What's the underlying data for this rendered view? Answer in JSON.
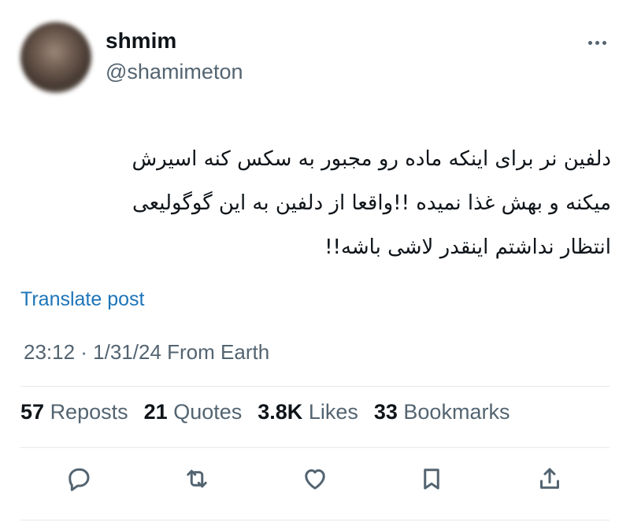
{
  "author": {
    "display_name": "shmim",
    "handle": "@shamimeton"
  },
  "post": {
    "lines": [
      "دلفین نر برای اینکه ماده رو مجبور به سکس کنه اسیرش",
      "میکنه و بهش غذا نمیده !!واقعا از دلفین به این گوگولیعی",
      "انتظار نداشتم اینقدر لاشی باشه!!"
    ],
    "translate_label": "Translate post",
    "timestamp": "23:12 · 1/31/24 From Earth"
  },
  "stats": {
    "reposts": {
      "count": "57",
      "label": "Reposts"
    },
    "quotes": {
      "count": "21",
      "label": "Quotes"
    },
    "likes": {
      "count": "3.8K",
      "label": "Likes"
    },
    "bookmarks": {
      "count": "33",
      "label": "Bookmarks"
    }
  },
  "icons": {
    "more": "more-horizontal-icon",
    "reply": "reply-icon",
    "repost": "repost-icon",
    "like": "heart-icon",
    "bookmark": "bookmark-icon",
    "share": "share-icon"
  },
  "colors": {
    "link": "#1d74b8",
    "secondary_text": "#536471",
    "primary_text": "#0f1419"
  }
}
